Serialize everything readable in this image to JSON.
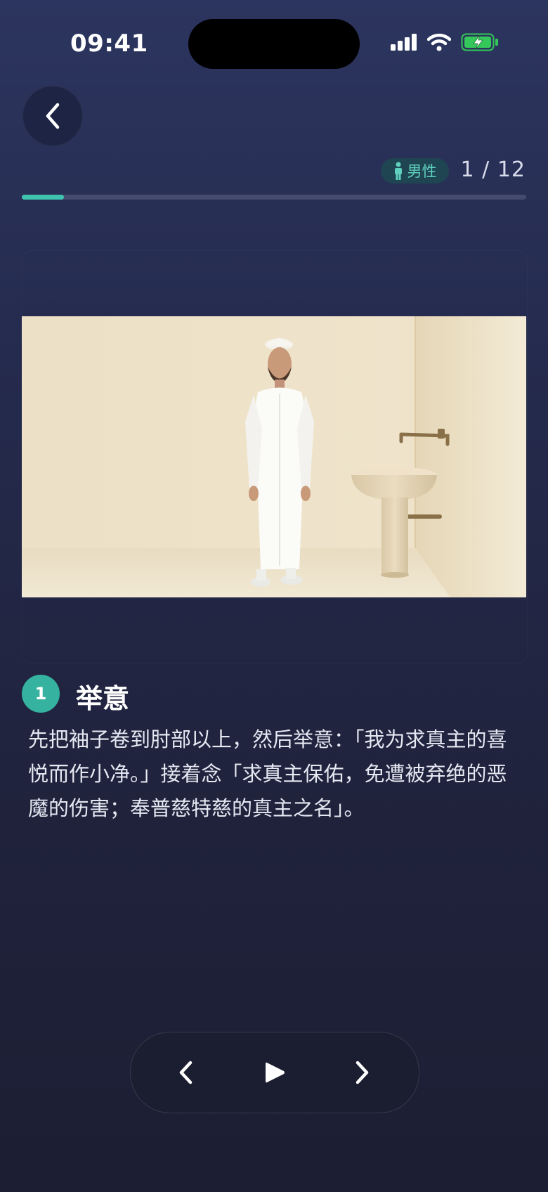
{
  "status_bar": {
    "time": "09:41"
  },
  "header": {
    "gender_label": "男性",
    "step_counter": "1 / 12",
    "progress_fraction": 0.083
  },
  "step": {
    "number": "1",
    "title": "举意",
    "description": "先把袖子卷到肘部以上，然后举意：「我为求真主的喜悦而作小净。」接着念「求真主保佑，免遭被弃绝的恶魔的伤害；奉普慈特慈的真主之名」。"
  },
  "colors": {
    "accent": "#3fc2ae",
    "badge_bg": "#1f4553",
    "battery": "#34c759"
  },
  "icons": [
    "back-chevron-icon",
    "person-icon",
    "previous-icon",
    "play-icon",
    "next-icon",
    "signal-icon",
    "wifi-icon",
    "battery-icon"
  ]
}
